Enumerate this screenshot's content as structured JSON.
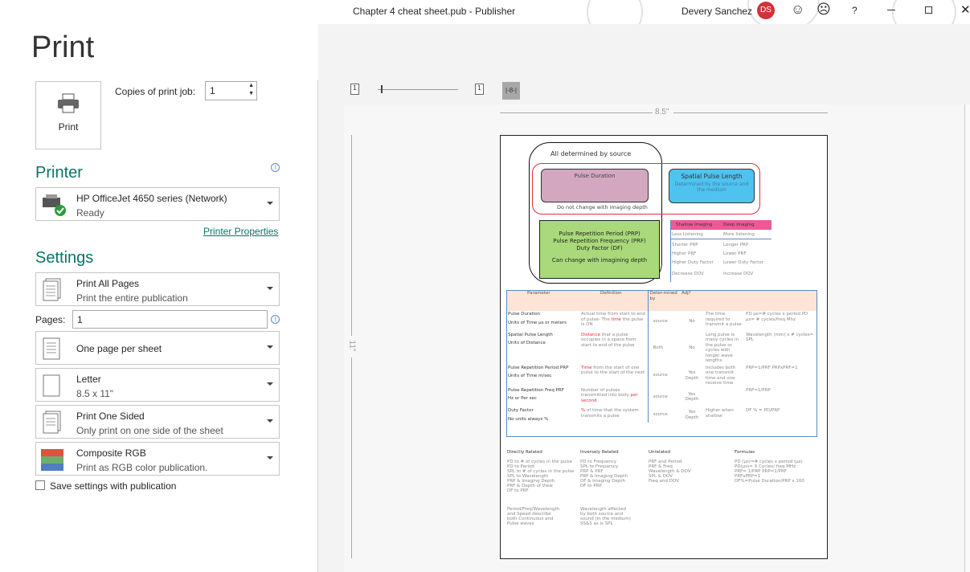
{
  "window": {
    "title": "Chapter 4 cheat sheet.pub  -  Publisher",
    "user": "Devery Sanchez",
    "initials": "DS",
    "help": "?"
  },
  "print": {
    "heading": "Print",
    "button": "Print",
    "copies_label": "Copies of print job:",
    "copies_value": "1"
  },
  "printer": {
    "heading": "Printer",
    "name": "HP OfficeJet 4650 series (Network)",
    "status": "Ready",
    "properties_link": "Printer Properties"
  },
  "settings": {
    "heading": "Settings",
    "pages_label": "Pages:",
    "pages_value": "1",
    "items": [
      {
        "title": "Print All Pages",
        "sub": "Print the entire publication"
      },
      {
        "title": "One page per sheet",
        "sub": ""
      },
      {
        "title": "Letter",
        "sub": "8.5 x 11\""
      },
      {
        "title": "Print One Sided",
        "sub": "Only print on one side of the sheet"
      },
      {
        "title": "Composite RGB",
        "sub": "Print as RGB color publication."
      }
    ],
    "save_checkbox": "Save settings with publication",
    "save_checked": false
  },
  "preview": {
    "page_icon_label": "1",
    "ruler_width": "8.5\"",
    "ruler_height": "11\"",
    "fit_label": "|-8-|"
  },
  "doc": {
    "all_determined": "All determined by source",
    "pulse_duration": "Pulse Duration",
    "no_change": "Do not change with imaging depth",
    "spl_title": "Spatial Pulse Length",
    "spl_sub": "Determined by the source and the medium",
    "green": [
      "Pulse Repetition Period (PRP)",
      "Pulse Repetition Frequency (PRF)",
      "Duty Factor (DF)"
    ],
    "green_note": "Can change with imagining depth",
    "depth_table": {
      "headers": [
        "Shallow Imaging",
        "Deep Imaging"
      ],
      "rows": [
        [
          "Less Listening",
          "More listening"
        ],
        [
          "Shorter PRP",
          "Longer PRP"
        ],
        [
          "Higher PRF",
          "Lower PRF"
        ],
        [
          "Higher Duty Factor",
          "Lower Duty Factor"
        ],
        [
          "Decrease DOV",
          "Increase DOV"
        ]
      ]
    },
    "main_table": {
      "headers": [
        "Parameter",
        "Definition",
        "Deter-mined by",
        "Adj?",
        "",
        ""
      ],
      "rows": [
        {
          "p1": "Pulse Duration",
          "p2": "Units of Time µs or meters",
          "d": "Actual time from start to end of pulse- The ",
          "dh": "time",
          "d2": " the pulse is ON",
          "det": "source",
          "adj": "No",
          "note": "The time required to transmit a pulse",
          "f": "PD µs=# cycles x period PD µs= # cycles/freq Mhz"
        },
        {
          "p1": "Spatial Pulse Length",
          "p2": "Units of Distance",
          "d": "",
          "dh": "Distance",
          "d2": " that a pulse occupies in a space from start to end of the pulse",
          "det": "Both",
          "adj": "No",
          "note": "Long pulse is many cycles in the pulse or cycles with longer wave lengths",
          "f": "Wavelength (mm) x # cycles= SPL"
        },
        {
          "p1": "Pulse Repetition Period PRP",
          "p2": "Units of Time m/sec",
          "d": "",
          "dh": "Time",
          "d2": " from the start of one pulse to the start of the next",
          "det": "source",
          "adj": "Yes Depth",
          "note": "Includes both one transmit time and one receive time",
          "f": "PRP=1/PRF  PRPxPRF=1"
        },
        {
          "p1": "Pulse Repetition Freq PRF",
          "p2": "Hz or Per sec",
          "d": "Number of pulses transmitted into body ",
          "dh": "per second",
          "d2": "",
          "det": "source",
          "adj": "Yes Depth",
          "note": "",
          "f": "PRF=1/PRP"
        },
        {
          "p1": "Duty Factor",
          "p2": "No units always %",
          "d": "",
          "dh": "%",
          "d2": " of time that the system transmits a pulse",
          "det": "source",
          "adj": "Yes Depth",
          "note": "Higher when shallow",
          "f": "DF % = PD/PRP"
        }
      ]
    },
    "lists": [
      {
        "title": "Directly Related",
        "items": [
          "PD to # of cycles in the pulse",
          "PD to Period",
          "SPL to # of cycles in the pulse",
          "SPL to Wavelength",
          "PRP & Imaging Depth",
          "PRF & Depth of View",
          "DF to PRF"
        ]
      },
      {
        "title": "Inversely Related",
        "items": [
          "PD to Frequency",
          "SPL to Frequency",
          "PRP & PRF",
          "PRF & Imaging Depth",
          "DF & Imaging Depth",
          "DF to PRP"
        ]
      },
      {
        "title": "Unrelated",
        "items": [
          "PRF and Period",
          "PRF & Freq",
          "Wavelength & DOV",
          "SPL & DOV",
          "Freq and DOV"
        ]
      },
      {
        "title": "Formulas",
        "items": [
          "PD (µs)=# cycles x period (µs)",
          "PD(µs)= X Cycles/ freq MHz",
          "PRF= 1/PRP    PRP=1/PRF",
          "PRFxPRP=1",
          "DF%=Pulse Duration/PRP x 100"
        ]
      }
    ],
    "notes": [
      "Period/Freq/Wavelength and Speed describe both Continuous and Pulse waves",
      "Wavelength affected by both source and sound (in the medium) SS&S as is SPL"
    ]
  }
}
